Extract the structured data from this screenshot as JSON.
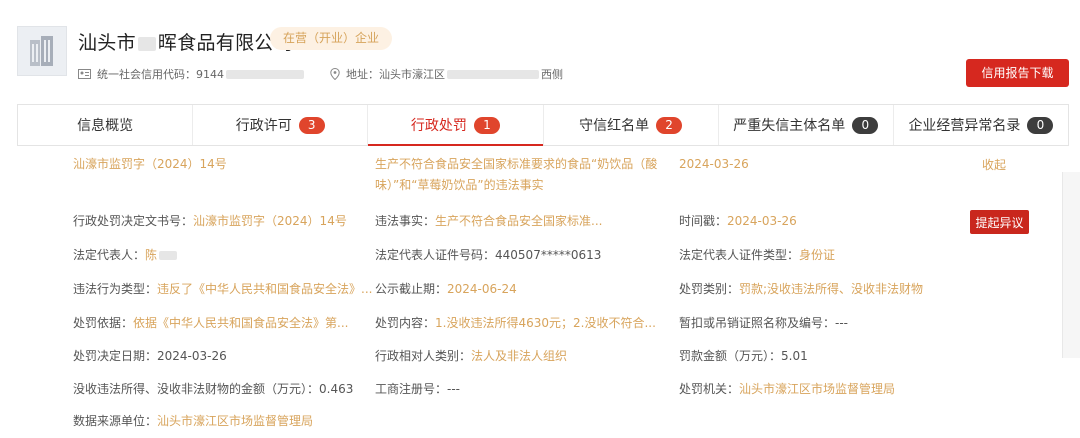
{
  "company": {
    "name_prefix": "汕头市",
    "name_suffix": "晖食品有限公司",
    "status": "在营（开业）企业",
    "credit_code_label": "统一社会信用代码：",
    "credit_code_visible": "9144",
    "address_label": "地址：",
    "address_prefix": "汕头市濠江区",
    "address_suffix": "西侧",
    "report_button": "信用报告下载"
  },
  "tabs": [
    {
      "label": "信息概览",
      "count": ""
    },
    {
      "label": "行政许可",
      "count": "3"
    },
    {
      "label": "行政处罚",
      "count": "1"
    },
    {
      "label": "守信红名单",
      "count": "2"
    },
    {
      "label": "严重失信主体名单",
      "count": "0"
    },
    {
      "label": "企业经营异常名录",
      "count": "0"
    }
  ],
  "record": {
    "doc_number": "汕濠市监罚字（2024）14号",
    "title": "生产不符合食品安全国家标准要求的食品“奶饮品（酸味）”和“草莓奶饮品”的违法事实",
    "date": "2024-03-26",
    "collapse": "收起"
  },
  "details": {
    "decision_doc_label": "行政处罚决定文书号：",
    "decision_doc_value": "汕濠市监罚字（2024）14号",
    "illegal_fact_label": "违法事实：",
    "illegal_fact_value": "生产不符合食品安全国家标准...",
    "timestamp_label": "时间戳：",
    "timestamp_value": "2024-03-26",
    "objection_button": "提起异议",
    "legal_rep_label": "法定代表人：",
    "legal_rep_value": "陈",
    "legal_rep_id_label": "法定代表人证件号码：",
    "legal_rep_id_value": "440507*****0613",
    "legal_rep_id_type_label": "法定代表人证件类型：",
    "legal_rep_id_type_value": "身份证",
    "violation_type_label": "违法行为类型：",
    "violation_type_value": "违反了《中华人民共和国食品安全法》...",
    "publicity_end_label": "公示截止期：",
    "publicity_end_value": "2024-06-24",
    "penalty_category_label": "处罚类别：",
    "penalty_category_value": "罚款;没收违法所得、没收非法财物",
    "basis_label": "处罚依据：",
    "basis_value": "依据《中华人民共和国食品安全法》第...",
    "content_label": "处罚内容：",
    "content_value": "1.没收违法所得4630元；2.没收不符合...",
    "suspend_label": "暂扣或吊销证照名称及编号：",
    "suspend_value": "---",
    "decision_date_label": "处罚决定日期：",
    "decision_date_value": "2024-03-26",
    "counterpart_type_label": "行政相对人类别：",
    "counterpart_type_value": "法人及非法人组织",
    "fine_label": "罚款金额（万元）：",
    "fine_value": "5.01",
    "confiscated_label": "没收违法所得、没收非法财物的金额（万元）：",
    "confiscated_value": "0.463",
    "reg_no_label": "工商注册号：",
    "reg_no_value": "---",
    "authority_label": "处罚机关：",
    "authority_value": "汕头市濠江区市场监督管理局",
    "source_label": "数据来源单位：",
    "source_value": "汕头市濠江区市场监督管理局"
  }
}
